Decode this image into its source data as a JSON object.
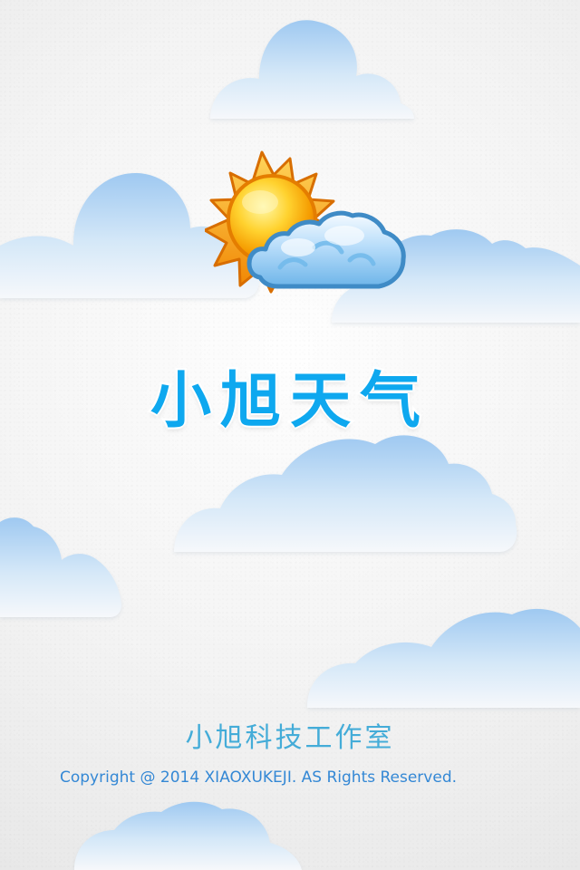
{
  "app": {
    "title": "小旭天气",
    "studio": "小旭科技工作室",
    "copyright": "Copyright @ 2014 XIAOXUKEJI. AS Rights Reserved."
  },
  "icons": {
    "logo": "sun-behind-cloud-icon"
  },
  "colors": {
    "title": "#0EA8EF",
    "studio": "#44ACD8",
    "copyright": "#3488D5",
    "cloud_blue": "#A8CFF0",
    "sun_orange": "#F6A500"
  }
}
